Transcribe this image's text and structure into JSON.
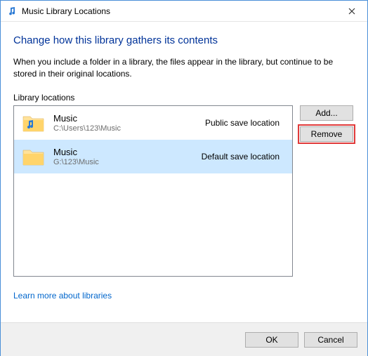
{
  "window": {
    "title": "Music Library Locations"
  },
  "heading": "Change how this library gathers its contents",
  "description": "When you include a folder in a library, the files appear in the library, but continue to be stored in their original locations.",
  "section_label": "Library locations",
  "locations": [
    {
      "name": "Music",
      "path": "C:\\Users\\123\\Music",
      "status": "Public save location",
      "selected": false,
      "icon": "music-folder"
    },
    {
      "name": "Music",
      "path": "G:\\123\\Music",
      "status": "Default save location",
      "selected": true,
      "icon": "folder"
    }
  ],
  "buttons": {
    "add": "Add...",
    "remove": "Remove",
    "ok": "OK",
    "cancel": "Cancel"
  },
  "learn_link": "Learn more about libraries",
  "colors": {
    "heading": "#003399",
    "link": "#0066cc",
    "selection": "#cde8ff",
    "highlight": "#e03a3a"
  }
}
